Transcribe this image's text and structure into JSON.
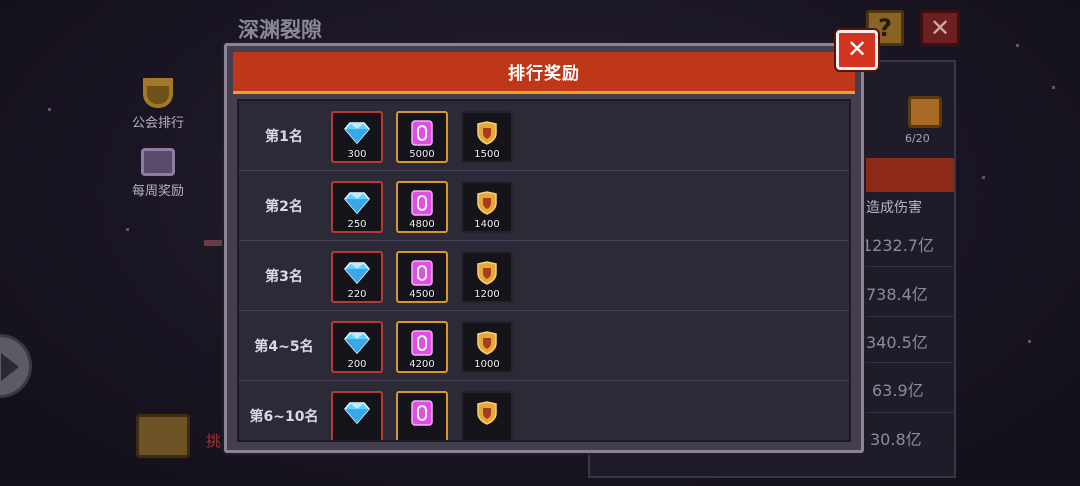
{
  "background": {
    "title": "深渊裂隙",
    "help_label": "?",
    "close_label": "✕",
    "side_items": [
      {
        "label": "公会排行",
        "icon": "trophy-icon"
      },
      {
        "label": "每周奖励",
        "icon": "scroll-icon"
      }
    ],
    "challenge_label": "挑",
    "right_panel": {
      "chest_count": "6/20",
      "header": "造成伤害",
      "damage_values": [
        "1232.7亿",
        "738.4亿",
        "340.5亿",
        "63.9亿",
        "30.8亿"
      ]
    }
  },
  "modal": {
    "title": "排行奖励",
    "close_label": "✕",
    "rows": [
      {
        "rank": "第1名",
        "rewards": [
          {
            "type": "diamond",
            "qty": "300"
          },
          {
            "type": "crystal",
            "qty": "5000"
          },
          {
            "type": "shield",
            "qty": "1500"
          }
        ]
      },
      {
        "rank": "第2名",
        "rewards": [
          {
            "type": "diamond",
            "qty": "250"
          },
          {
            "type": "crystal",
            "qty": "4800"
          },
          {
            "type": "shield",
            "qty": "1400"
          }
        ]
      },
      {
        "rank": "第3名",
        "rewards": [
          {
            "type": "diamond",
            "qty": "220"
          },
          {
            "type": "crystal",
            "qty": "4500"
          },
          {
            "type": "shield",
            "qty": "1200"
          }
        ]
      },
      {
        "rank": "第4~5名",
        "rewards": [
          {
            "type": "diamond",
            "qty": "200"
          },
          {
            "type": "crystal",
            "qty": "4200"
          },
          {
            "type": "shield",
            "qty": "1000"
          }
        ]
      },
      {
        "rank": "第6~10名",
        "rewards": [
          {
            "type": "diamond",
            "qty": ""
          },
          {
            "type": "crystal",
            "qty": ""
          },
          {
            "type": "shield",
            "qty": ""
          }
        ]
      }
    ]
  },
  "colors": {
    "header_red": "#be3718",
    "header_gold_border": "#e6a128",
    "close_red": "#d33420",
    "diamond_blue": "#5fd0ff",
    "crystal_pink": "#e04fe6",
    "shield_gold": "#e7a83a"
  }
}
